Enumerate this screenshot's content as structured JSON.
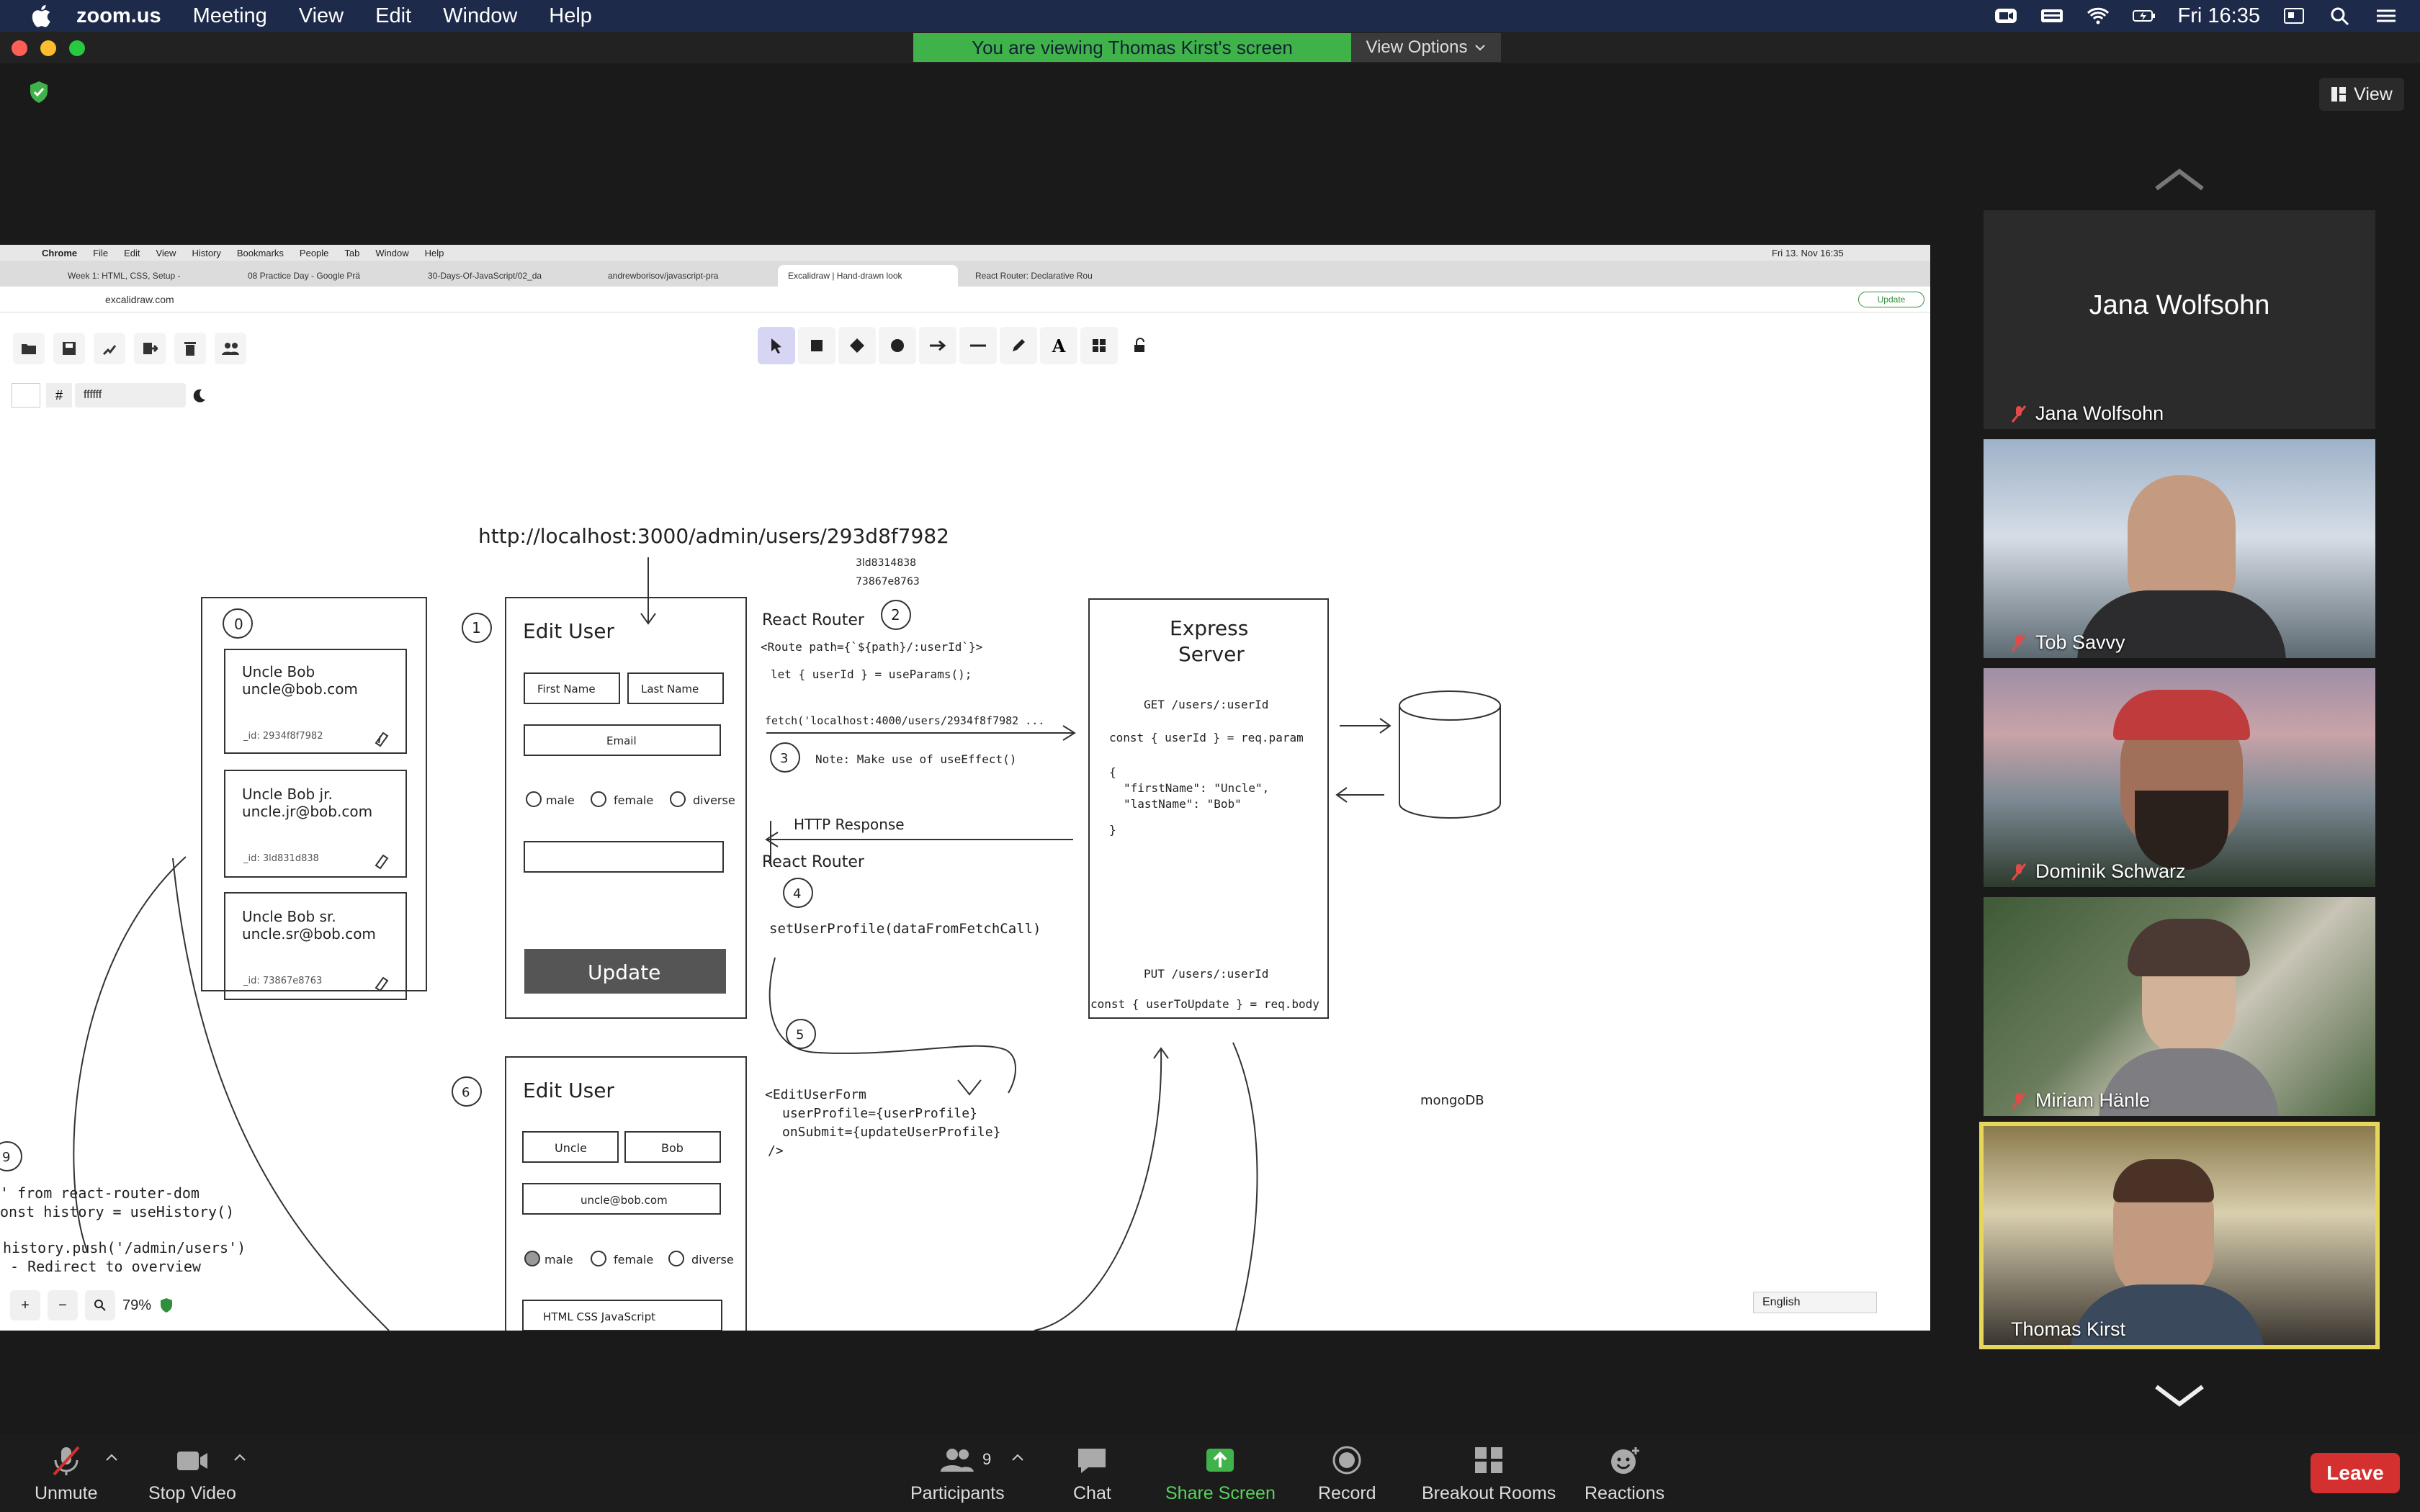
{
  "menubar": {
    "app": "zoom.us",
    "items": [
      "Meeting",
      "View",
      "Edit",
      "Window",
      "Help"
    ],
    "clock": "Fri 16:35"
  },
  "banner": {
    "text": "You are viewing Thomas Kirst's screen",
    "view_options": "View Options"
  },
  "view_button": "View",
  "shared_screen": {
    "chrome_menu": [
      "Chrome",
      "File",
      "Edit",
      "View",
      "History",
      "Bookmarks",
      "People",
      "Tab",
      "Window",
      "Help"
    ],
    "chrome_clock": "Fri 13. Nov 16:35",
    "tabs": [
      "Week 1: HTML, CSS, Setup -",
      "08 Practice Day - Google Prä",
      "30-Days-Of-JavaScript/02_da",
      "andrewborisov/javascript-pra",
      "Excalidraw | Hand-drawn look",
      "React Router: Declarative Rou"
    ],
    "url": "excalidraw.com",
    "update": "Update",
    "color_value": "ffffff",
    "zoom": "79%",
    "language": "English",
    "drawing": {
      "url_title": "http://localhost:3000/admin/users/293d8f7982",
      "ids_small": [
        "3ld8314838",
        "73867e8763"
      ],
      "users_num": "0",
      "users": [
        {
          "name": "Uncle Bob",
          "email": "uncle@bob.com",
          "id": "_id: 2934f8f7982"
        },
        {
          "name": "Uncle Bob jr.",
          "email": "uncle.jr@bob.com",
          "id": "_id: 3ld831d838"
        },
        {
          "name": "Uncle Bob sr.",
          "email": "uncle.sr@bob.com",
          "id": "_id: 73867e8763"
        }
      ],
      "form1": {
        "num": "1",
        "title": "Edit User",
        "first": "First Name",
        "last": "Last Name",
        "email": "Email",
        "male": "male",
        "female": "female",
        "diverse": "diverse",
        "update": "Update"
      },
      "router": {
        "label": "React Router",
        "num": "2",
        "line1": "<Route path={`${path}/:userId`}>",
        "line2": "let { userId } = useParams();",
        "fetch": "fetch('localhost:4000/users/2934f8f7982 ..."
      },
      "note": {
        "num": "3",
        "text": "Note: Make use of useEffect()"
      },
      "http": "HTTP Response",
      "step4": {
        "num": "4",
        "text": "setUserProfile(dataFromFetchCall)"
      },
      "step5": {
        "num": "5"
      },
      "form_code": [
        "<EditUserForm",
        "userProfile={userProfile}",
        "onSubmit={updateUserProfile}",
        "/>"
      ],
      "express": {
        "title1": "Express",
        "title2": "Server",
        "get": "GET /users/:userId",
        "get_code": "const { userId } = req.param",
        "json1": "{",
        "json2": "\"firstName\": \"Uncle\",",
        "json3": "\"lastName\": \"Bob\"",
        "json4": "}",
        "put": "PUT /users/:userId",
        "put_code": "const { userToUpdate } = req.body"
      },
      "db": "mongoDB",
      "form6": {
        "num": "6",
        "title": "Edit User",
        "first": "Uncle",
        "last": "Bob",
        "email": "uncle@bob.com",
        "male": "male",
        "female": "female",
        "diverse": "diverse",
        "skills": "HTML   CSS   JavaScript"
      },
      "step9": {
        "num": "9",
        "lines": [
          "' from react-router-dom",
          "onst history = useHistory()",
          "history.push('/admin/users')",
          "- Redirect to overview"
        ]
      }
    }
  },
  "participants": [
    {
      "name": "Jana Wolfsohn",
      "video": false
    },
    {
      "name": "Tob Savvy",
      "video": true
    },
    {
      "name": "Dominik Schwarz",
      "video": true
    },
    {
      "name": "Miriam Hänle",
      "video": true
    },
    {
      "name": "Thomas Kirst",
      "video": true,
      "speaking": true
    }
  ],
  "controls": {
    "unmute": "Unmute",
    "stop_video": "Stop Video",
    "participants": "Participants",
    "participants_count": "9",
    "chat": "Chat",
    "share": "Share Screen",
    "record": "Record",
    "breakout": "Breakout Rooms",
    "reactions": "Reactions",
    "leave": "Leave"
  },
  "colors": {
    "banner": "#3fb34a",
    "leave": "#d3302f",
    "share": "#58d25c",
    "speaker_outline": "#e6d65a"
  }
}
